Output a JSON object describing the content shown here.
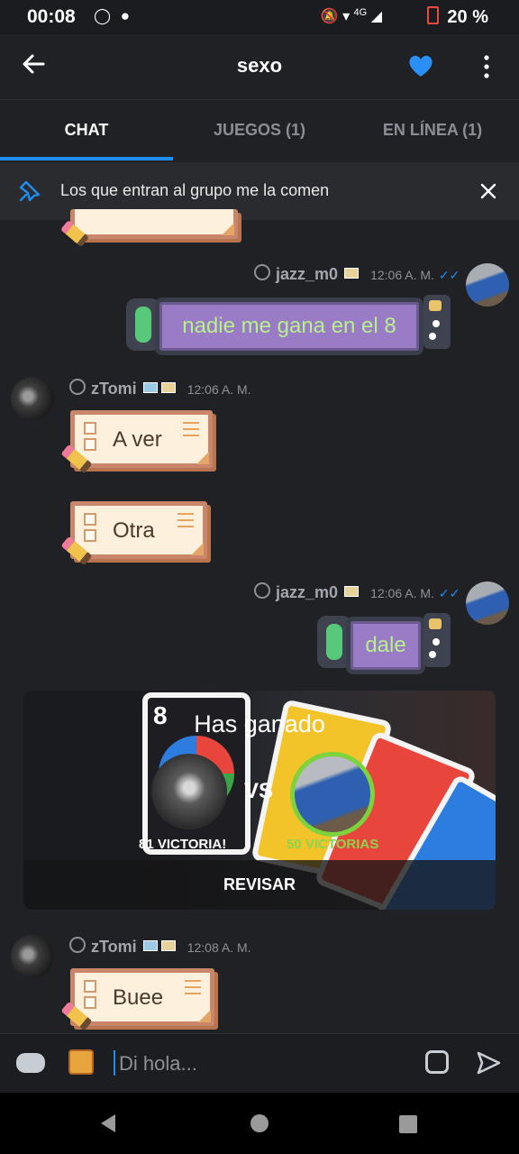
{
  "status_bar": {
    "time": "00:08",
    "battery": "20 %",
    "network": "4G"
  },
  "header": {
    "title": "sexo"
  },
  "tabs": [
    {
      "label": "CHAT",
      "active": true
    },
    {
      "label": "JUEGOS (1)",
      "active": false
    },
    {
      "label": "EN LÍNEA (1)",
      "active": false
    }
  ],
  "pinned": {
    "text": "Los que entran al grupo me la comen"
  },
  "messages": [
    {
      "author": "jazz_m0",
      "time": "12:06 A. M.",
      "text": "nadie me gana en el 8"
    },
    {
      "author": "zTomi",
      "time": "12:06 A. M.",
      "text": "A ver"
    },
    {
      "text": "Otra"
    },
    {
      "author": "jazz_m0",
      "time": "12:06 A. M.",
      "text": "dale"
    },
    {
      "author": "zTomi",
      "time": "12:08 A. M.",
      "text": "Buee"
    }
  ],
  "game_card": {
    "card_number": "8",
    "title": "Has ganado",
    "vs": "VS",
    "left_wins": "81 VICTORIA!",
    "right_wins": "50 VICTORIAS",
    "action": "REVISAR"
  },
  "composer": {
    "placeholder": "Di hola..."
  },
  "colors": {
    "accent": "#1f8df0",
    "background": "#202124",
    "win_green": "#8bd44c",
    "heart": "#2a8ff7"
  }
}
